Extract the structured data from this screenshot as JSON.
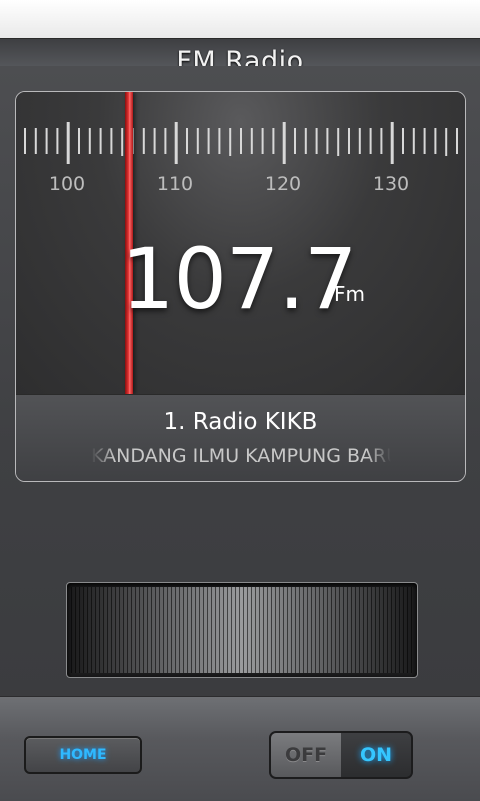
{
  "app": {
    "title": "FM Radio"
  },
  "dial": {
    "scale_labels": [
      "100",
      "110",
      "120",
      "130"
    ],
    "frequency": "107.7",
    "unit": "Fm"
  },
  "station": {
    "name": "1. Radio KIKB",
    "rds_text": "KANDANG ILMU KAMPUNG BARU"
  },
  "controls": {
    "home_label": "HOME",
    "power_off_label": "OFF",
    "power_on_label": "ON",
    "power_state": "on"
  },
  "colors": {
    "needle": "#e53535",
    "accent": "#35c6ff"
  }
}
